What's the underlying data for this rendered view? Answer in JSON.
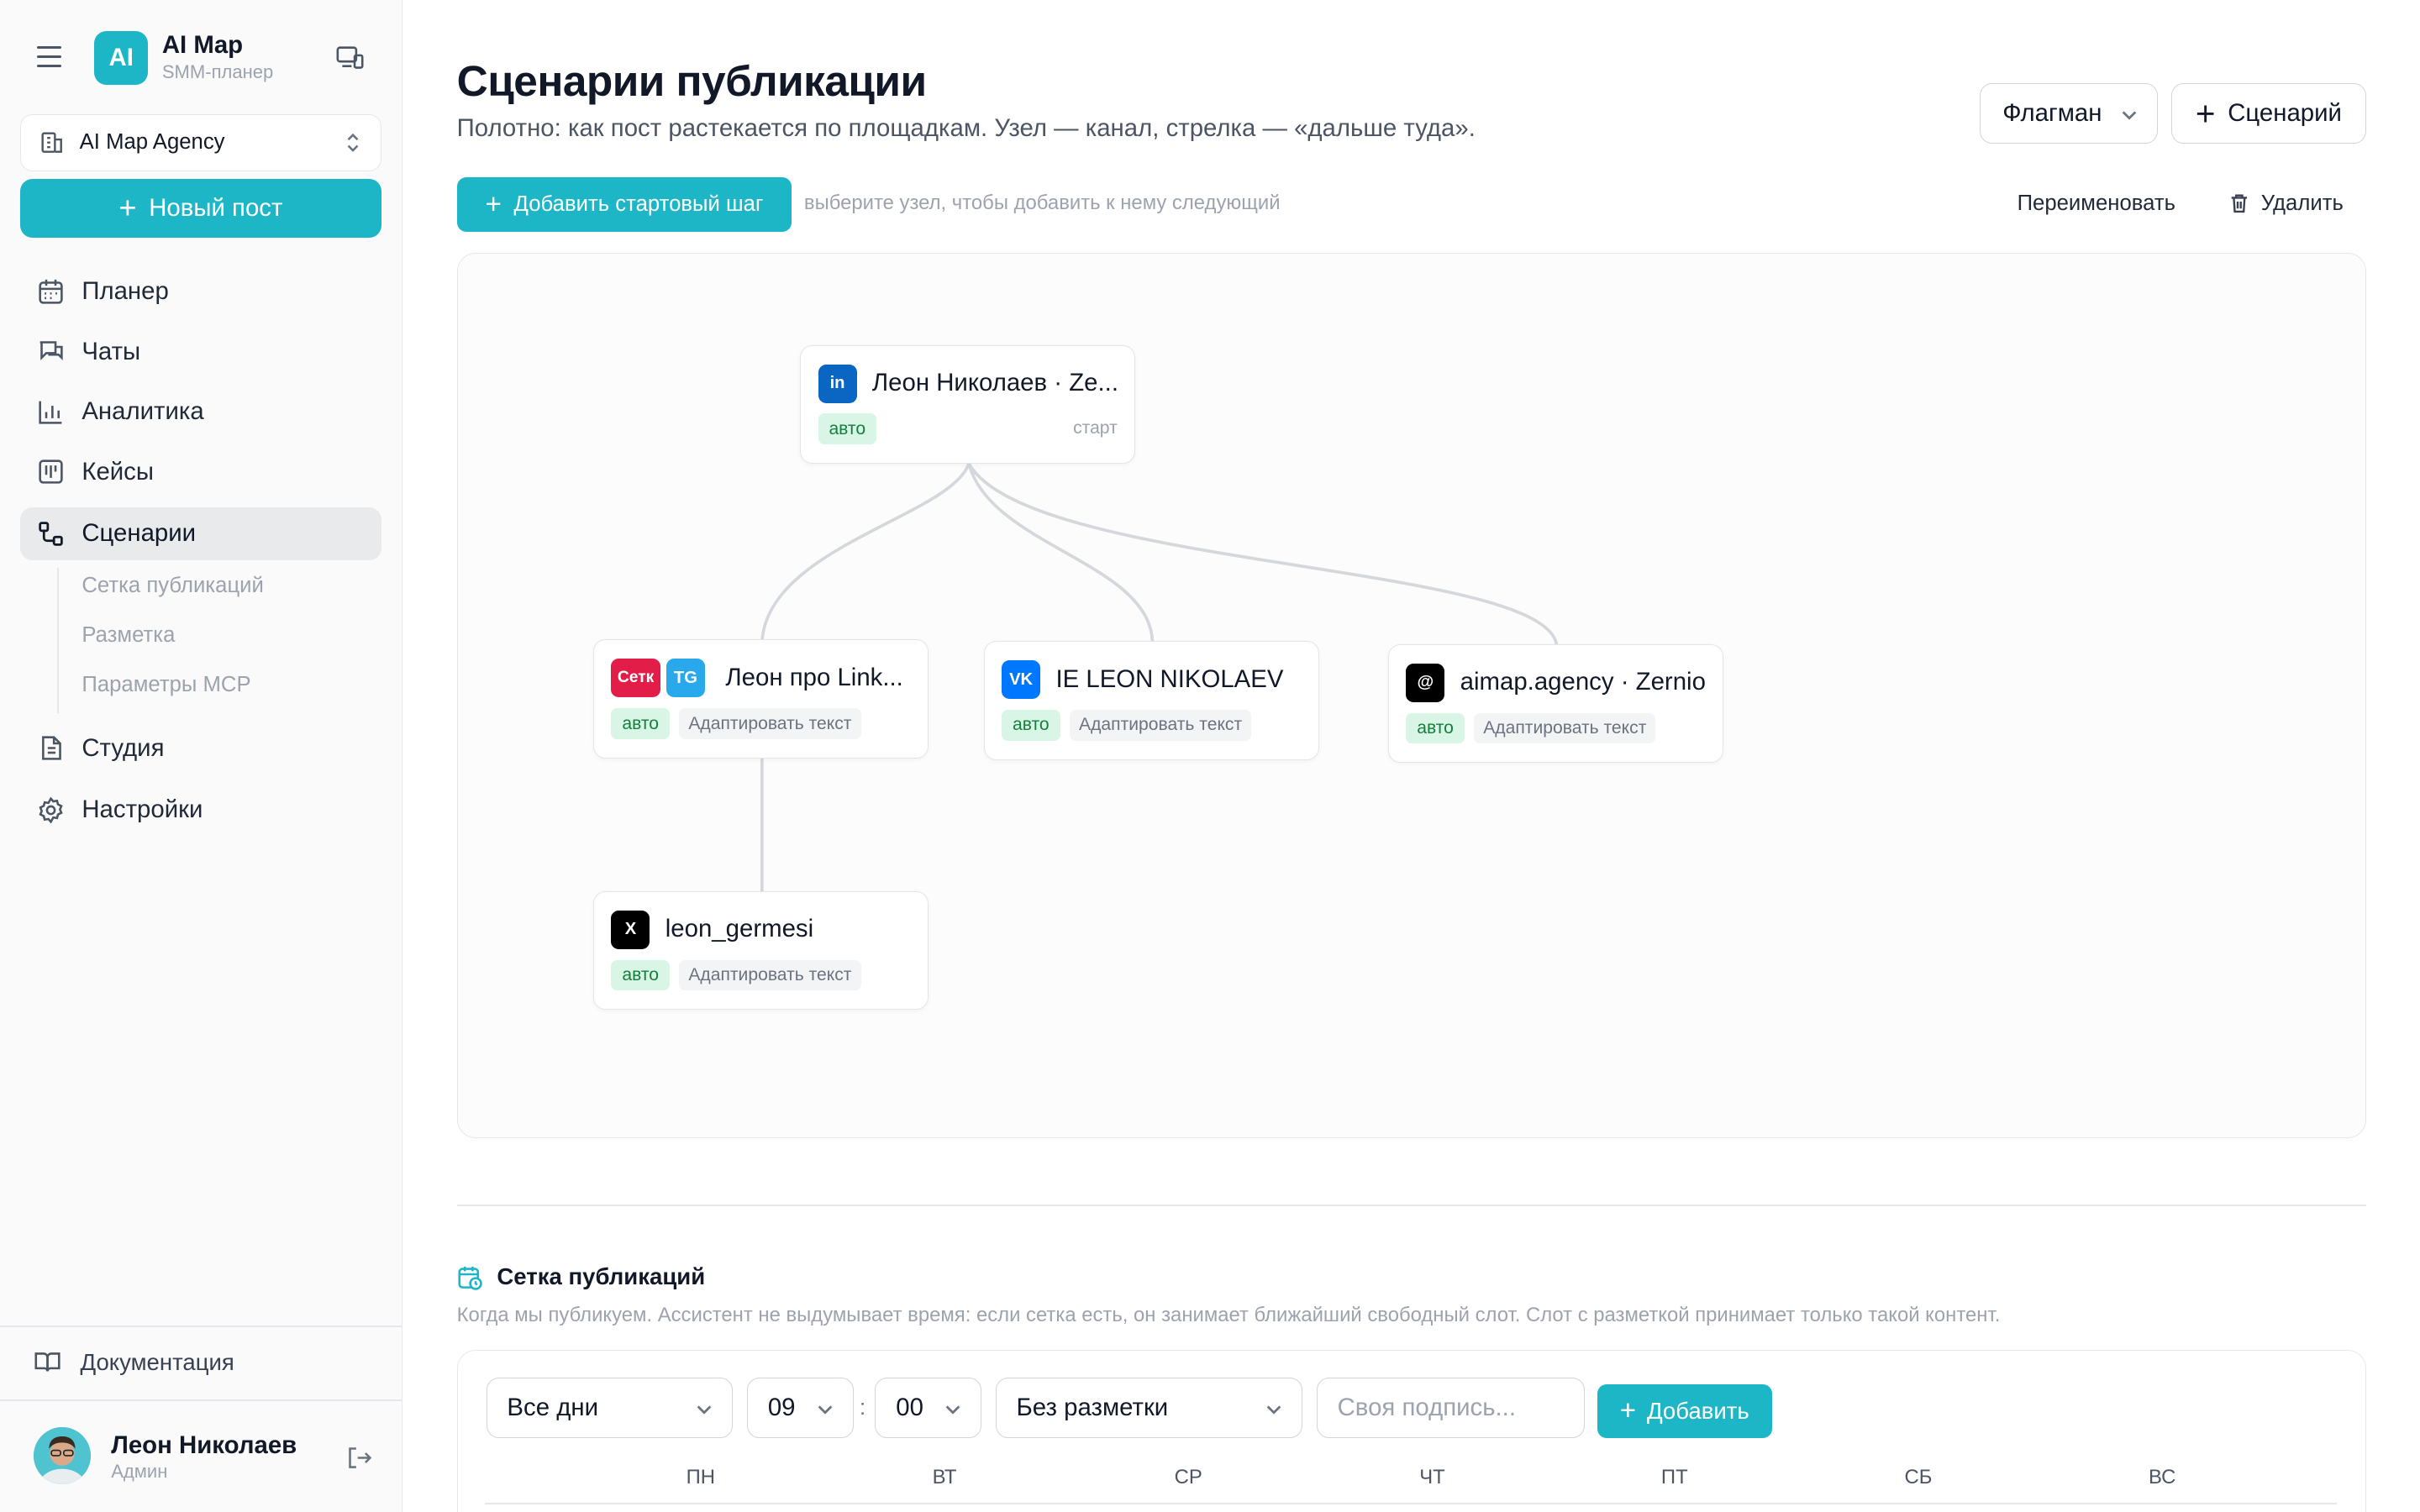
{
  "app": {
    "logo_text": "AI",
    "title": "AI Map",
    "subtitle": "SMM-планер",
    "accent_color": "#1db6c6"
  },
  "sidebar": {
    "agency_selector": "AI Map Agency",
    "new_post": "Новый пост",
    "nav": [
      {
        "label": "Планер",
        "icon": "calendar-icon"
      },
      {
        "label": "Чаты",
        "icon": "chat-icon"
      },
      {
        "label": "Аналитика",
        "icon": "bar-chart-icon"
      },
      {
        "label": "Кейсы",
        "icon": "kanban-icon"
      },
      {
        "label": "Сценарии",
        "icon": "workflow-icon",
        "active": true
      },
      {
        "label": "Студия",
        "icon": "document-icon"
      },
      {
        "label": "Настройки",
        "icon": "gear-icon"
      }
    ],
    "sub_items": [
      "Сетка публикаций",
      "Разметка",
      "Параметры MCP"
    ],
    "docs": "Документация",
    "user": {
      "name": "Леон Николаев",
      "role": "Админ"
    }
  },
  "header": {
    "title": "Сценарии публикации",
    "subtitle": "Полотно: как пост растекается по площадкам. Узел — канал, стрелка — «дальше туда».",
    "flagman": "Флагман",
    "new_scenario": "Сценарий"
  },
  "toolbar": {
    "add_start": "Добавить стартовый шаг",
    "hint": "выберите узел, чтобы добавить к нему следующий",
    "rename": "Переименовать",
    "delete": "Удалить"
  },
  "canvas": {
    "nodes": [
      {
        "id": "n1",
        "name": "Леон Николаев · Ze...",
        "badges": [
          {
            "text": "in",
            "color": "#0a66c2"
          }
        ],
        "auto": "авто",
        "start": "старт"
      },
      {
        "id": "n2",
        "name": "Леон про Link...",
        "badges": [
          {
            "text": "Сетк",
            "color": "#e11d48"
          },
          {
            "text": "TG",
            "color": "#29a9eb"
          }
        ],
        "auto": "авто",
        "adapt": "Адаптировать текст"
      },
      {
        "id": "n3",
        "name": "IE LEON NIKOLAEV",
        "badges": [
          {
            "text": "VK",
            "color": "#0077ff"
          }
        ],
        "auto": "авто",
        "adapt": "Адаптировать текст"
      },
      {
        "id": "n4",
        "name": "aimap.agency · Zernio",
        "badges": [
          {
            "text": "@",
            "color": "#000000"
          }
        ],
        "auto": "авто",
        "adapt": "Адаптировать текст"
      },
      {
        "id": "n5",
        "name": "leon_germesi",
        "badges": [
          {
            "text": "X",
            "color": "#000000"
          }
        ],
        "auto": "авто",
        "adapt": "Адаптировать текст"
      }
    ]
  },
  "schedule": {
    "title": "Сетка публикаций",
    "description": "Когда мы публикуем. Ассистент не выдумывает время: если сетка есть, он занимает ближайший свободный слот. Слот с разметкой принимает только такой контент.",
    "days_select": "Все дни",
    "hour": "09",
    "minute": "00",
    "markup_select": "Без разметки",
    "caption_placeholder": "Своя подпись...",
    "add": "Добавить",
    "weekdays": [
      "ПН",
      "ВТ",
      "СР",
      "ЧТ",
      "ПТ",
      "СБ",
      "ВС"
    ]
  }
}
